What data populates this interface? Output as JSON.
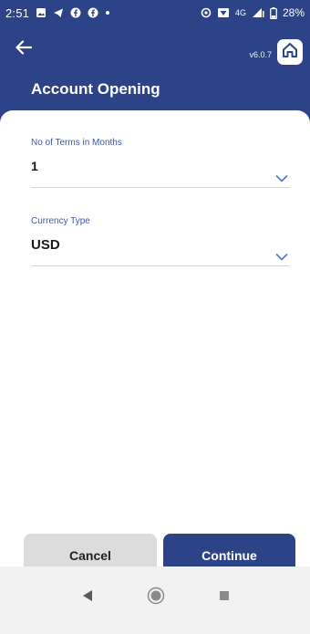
{
  "status_bar": {
    "time": "2:51",
    "network": "4G",
    "battery": "28%"
  },
  "header": {
    "version": "v6.0.7",
    "title": "Account Opening"
  },
  "form": {
    "terms": {
      "label": "No of Terms in Months",
      "value": "1"
    },
    "currency": {
      "label": "Currency Type",
      "value": "USD"
    }
  },
  "actions": {
    "cancel_label": "Cancel",
    "continue_label": "Continue"
  },
  "icons": {
    "back": "arrow-left-icon",
    "home": "home-icon",
    "chevron": "chevron-down-icon",
    "nav_back": "triangle-back-icon",
    "nav_home": "circle-home-icon",
    "nav_recents": "square-recents-icon"
  },
  "colors": {
    "primary": "#2d4387",
    "label": "#3f57a6",
    "chevron": "#4a78c9",
    "cancel_bg": "#dcdcdc",
    "nav_bg": "#f2f2f2"
  }
}
